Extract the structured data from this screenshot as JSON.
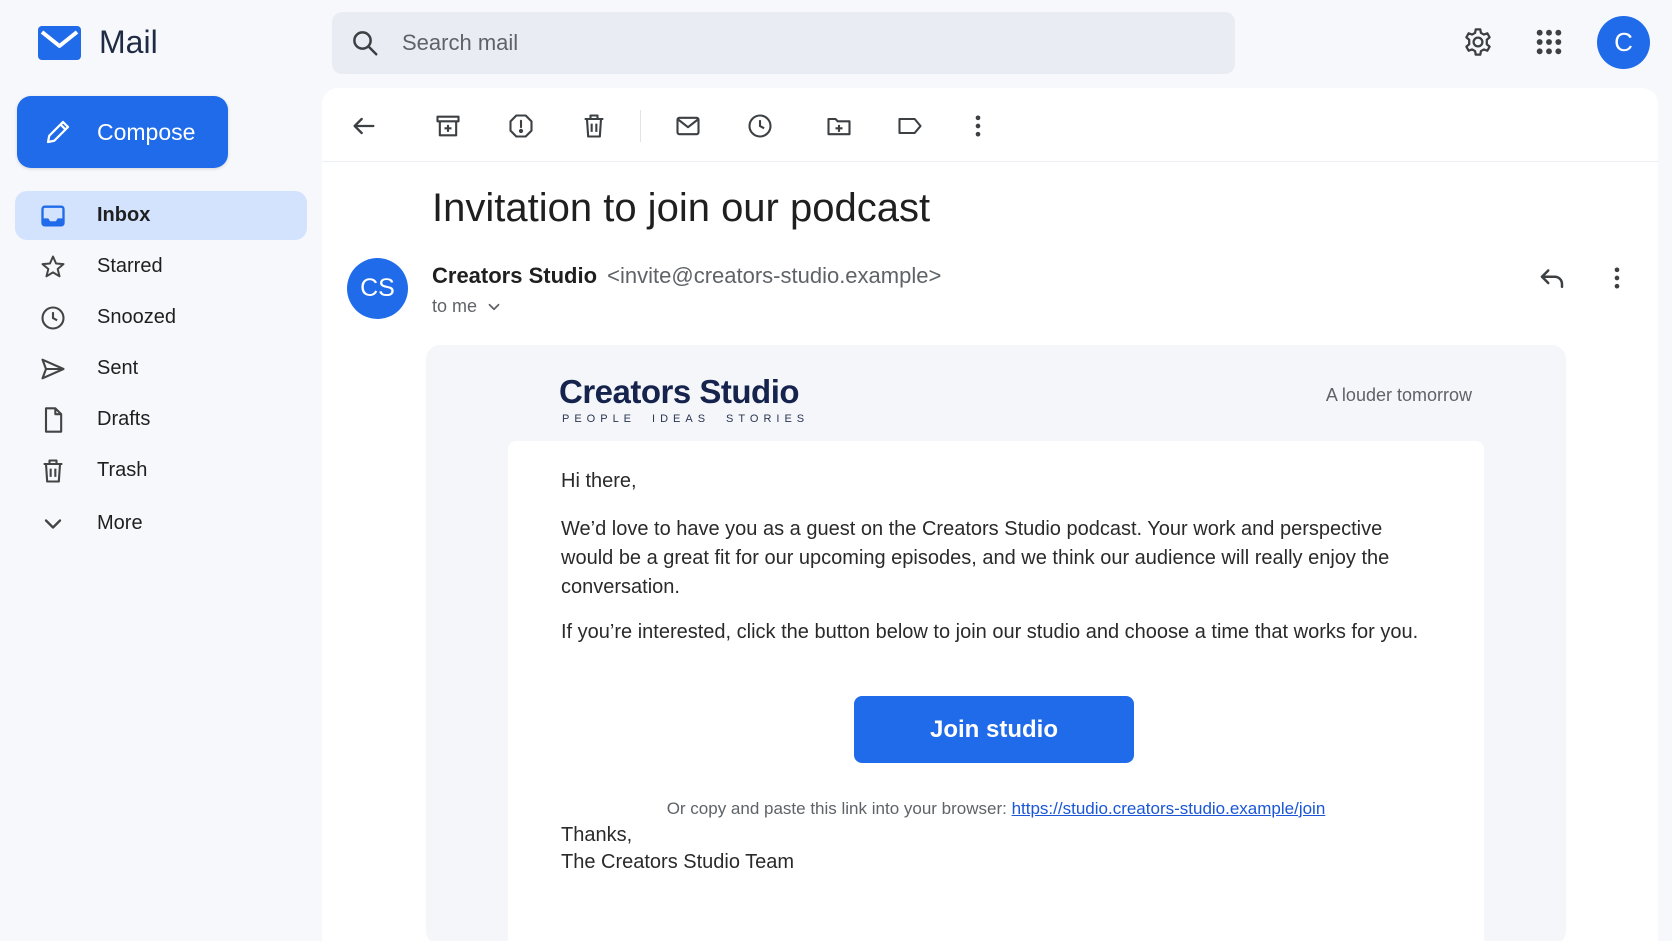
{
  "app": {
    "name": "Mail"
  },
  "compose": {
    "label": "Compose"
  },
  "nav": [
    {
      "label": "Inbox",
      "icon": "inbox-icon",
      "active": true
    },
    {
      "label": "Starred",
      "icon": "star-icon"
    },
    {
      "label": "Snoozed",
      "icon": "clock-icon"
    },
    {
      "label": "Sent",
      "icon": "send-icon"
    },
    {
      "label": "Drafts",
      "icon": "draft-icon"
    },
    {
      "label": "Trash",
      "icon": "trash-icon"
    },
    {
      "label": "More",
      "icon": "chevron-down-icon"
    }
  ],
  "search": {
    "placeholder": "Search mail"
  },
  "account": {
    "initial": "C"
  },
  "message": {
    "subject": "Invitation to join our podcast",
    "sender_initials": "CS",
    "sender_name": "Creators Studio",
    "sender_email": "<invite@creators-studio.example>",
    "to": "to me"
  },
  "email": {
    "logo_title": "Creators Studio",
    "logo_tags": [
      "PEOPLE",
      "IDEAS",
      "STORIES"
    ],
    "tagline": "A louder tomorrow",
    "greeting": "Hi there,",
    "para1": "We’d love to have you as a guest on the Creators Studio podcast. Your work and perspective would be a great fit for our upcoming episodes, and we think our audience will really enjoy the conversation.",
    "para2": "If you’re interested, click the button below to join our studio and choose a time that works for you.",
    "button": "Join studio",
    "copy_text": "Or copy and paste this link into your browser: ",
    "link": "https://studio.creators-studio.example/join",
    "signoff": "Thanks,",
    "signature": "The Creators Studio Team"
  },
  "colors": {
    "accent": "#1f6bea",
    "active_nav": "#d3e3fd",
    "link": "#1a56d6"
  }
}
